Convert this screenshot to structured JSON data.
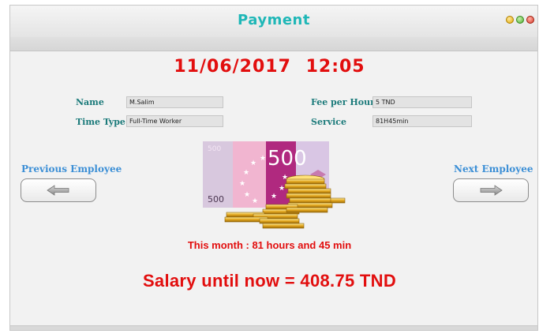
{
  "window": {
    "title": "Payment",
    "buttons": [
      "minimize",
      "maximize",
      "close"
    ]
  },
  "datetime": {
    "date": "11/06/2017",
    "time": "12:05"
  },
  "employee": {
    "name_label": "Name",
    "name_value": "M.Salim",
    "time_type_label": "Time Type",
    "time_type_value": "Full-Time Worker",
    "fee_label": "Fee per Hour",
    "fee_value": "5 TND",
    "service_label": "Service",
    "service_value": "81H45min"
  },
  "navigation": {
    "previous_label": "Previous Employee",
    "next_label": "Next Employee"
  },
  "banknote": {
    "denomination": "500",
    "small_number": "500"
  },
  "summary": {
    "month_text": "This month : 81 hours and 45 min",
    "salary_text": "Salary until now = 408.75 TND"
  },
  "colors": {
    "title": "#1fb7b7",
    "highlight_red": "#e20e0e",
    "label_teal": "#1b7a7a",
    "nav_blue": "#3c8fd6"
  }
}
